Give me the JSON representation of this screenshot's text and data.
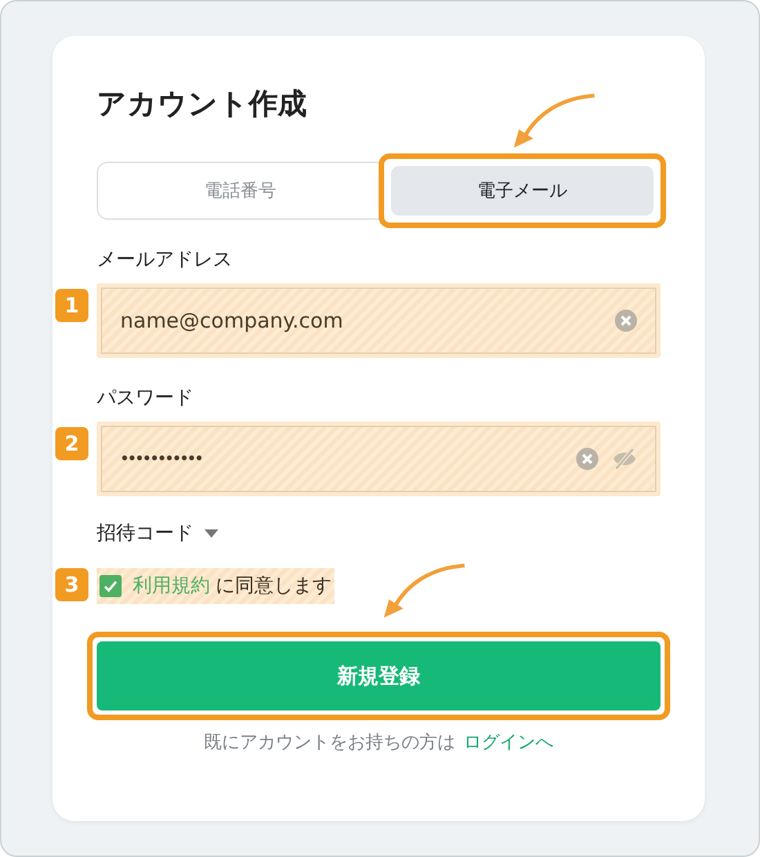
{
  "title": "アカウント作成",
  "tabs": [
    {
      "label": "電話番号",
      "selected": false,
      "highlighted": false
    },
    {
      "label": "電子メール",
      "selected": true,
      "highlighted": true
    }
  ],
  "fields": [
    {
      "label": "メールアドレス",
      "value": "name@company.com",
      "badge": "1",
      "kind": "email"
    },
    {
      "label": "パスワード",
      "value": "•••••••••••",
      "badge": "2",
      "kind": "password"
    }
  ],
  "invite": {
    "label": "招待コード",
    "expanded": false
  },
  "terms": {
    "badge": "3",
    "checked": true,
    "link": "利用規約",
    "text": "に同意します"
  },
  "submit": {
    "label": "新規登録",
    "highlighted": true
  },
  "login": {
    "text": "既にアカウントをお持ちの方は",
    "link": "ログインへ"
  }
}
